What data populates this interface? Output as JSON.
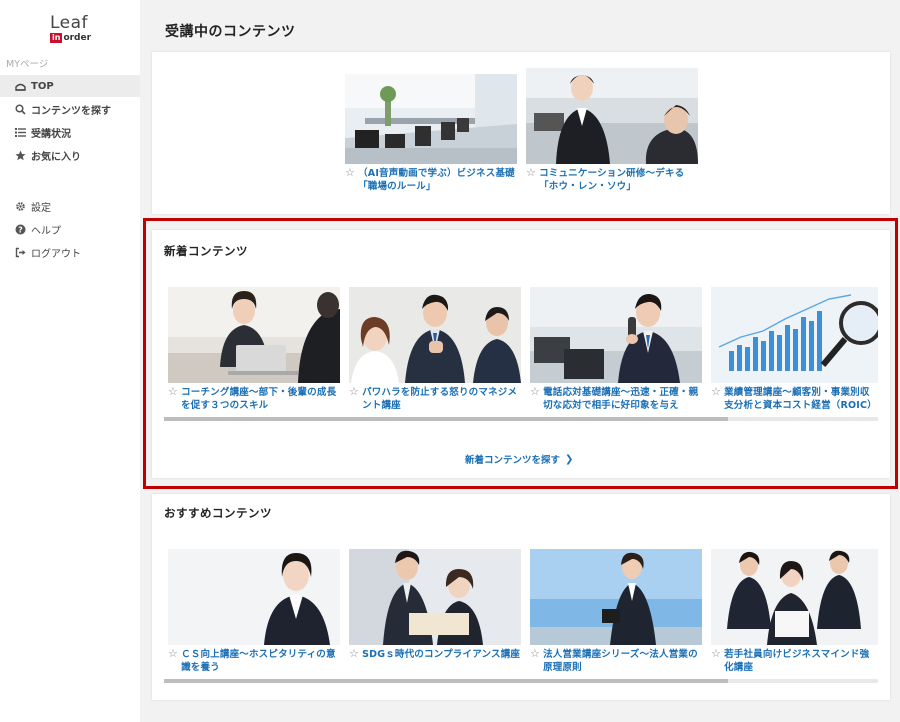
{
  "brand": {
    "leaf": "Leaf",
    "in": "in",
    "order": "order"
  },
  "sidebar": {
    "section_label": "MYページ",
    "items": [
      {
        "label": "TOP",
        "icon": "home-icon"
      },
      {
        "label": "コンテンツを探す",
        "icon": "search-icon"
      },
      {
        "label": "受講状況",
        "icon": "list-icon"
      },
      {
        "label": "お気に入り",
        "icon": "star-icon"
      }
    ],
    "bottom_items": [
      {
        "label": "設定",
        "icon": "gear-icon"
      },
      {
        "label": "ヘルプ",
        "icon": "help-icon"
      },
      {
        "label": "ログアウト",
        "icon": "logout-icon"
      }
    ]
  },
  "main": {
    "page_title": "受講中のコンテンツ",
    "in_progress": [
      {
        "title": "（AI音声動画で学ぶ）ビジネス基礎「職場のルール」"
      },
      {
        "title": "コミュニケーション研修～デキる「ホウ・レン・ソウ」"
      }
    ],
    "new_section": {
      "title": "新着コンテンツ",
      "items": [
        {
          "title": "コーチング講座～部下・後輩の成長を促す３つのスキル"
        },
        {
          "title": "パワハラを防止する怒りのマネジメント講座"
        },
        {
          "title": "電話応対基礎講座～迅速・正確・親切な応対で相手に好印象を与え"
        },
        {
          "title": "業績管理講座～顧客別・事業別収支分析と資本コスト経営（ROIC）"
        }
      ],
      "more_label": "新着コンテンツを探す"
    },
    "recommended_section": {
      "title": "おすすめコンテンツ",
      "items": [
        {
          "title": "ＣＳ向上講座～ホスピタリティの意識を養う"
        },
        {
          "title": "SDGｓ時代のコンプライアンス講座"
        },
        {
          "title": "法人営業講座シリーズ～法人営業の原理原則"
        },
        {
          "title": "若手社員向けビジネスマインド強化講座"
        }
      ]
    }
  },
  "colors": {
    "accent": "#1a6fb5",
    "highlight": "#c00000",
    "brand_red": "#c8102e"
  }
}
